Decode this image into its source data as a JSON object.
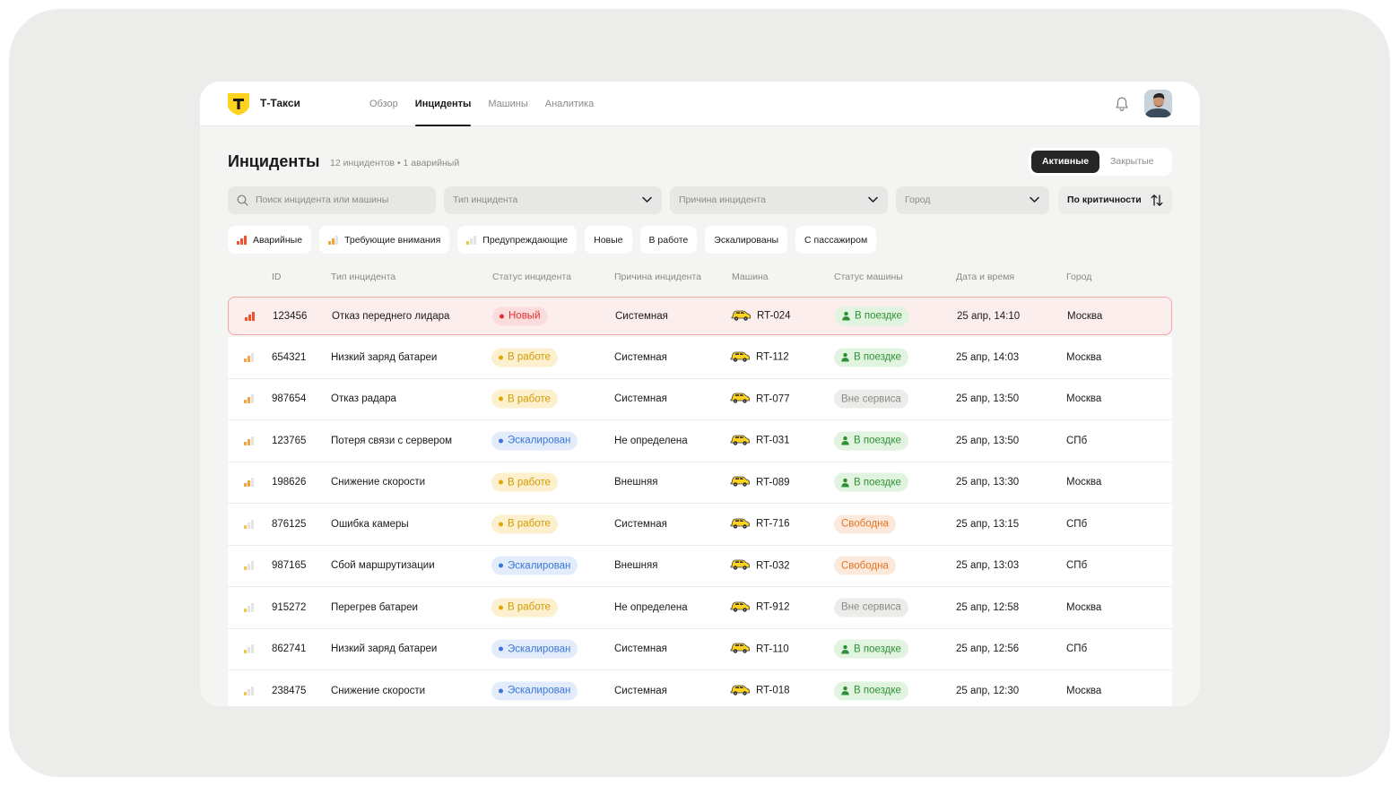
{
  "brand": "Т-Такси",
  "logo_letter": "T",
  "nav": [
    "Обзор",
    "Инциденты",
    "Машины",
    "Аналитика"
  ],
  "active_nav": "Инциденты",
  "page_title": "Инциденты",
  "summary": "12 инцидентов  •  1 аварийный",
  "tabs": [
    "Активные",
    "Закрытые"
  ],
  "active_tab": "Активные",
  "filters": {
    "search_placeholder": "Поиск инцидента или машины",
    "type_placeholder": "Тип инцидента",
    "reason_placeholder": "Причина инцидента",
    "city_placeholder": "Город",
    "sort_label": "По критичности"
  },
  "chips": [
    "Аварийные",
    "Требующие внимания",
    "Предупреждающие",
    "Новые",
    "В работе",
    "Эскалированы",
    "С пассажиром"
  ],
  "columns": [
    "ID",
    "Тип инцидента",
    "Статус инцидента",
    "Причина инцидента",
    "Машина",
    "Статус машины",
    "Дата и время",
    "Город"
  ],
  "colors": {
    "severity_high": "#f0502a",
    "severity_mid": "#f5a33a",
    "severity_low": "#f4c542",
    "severity_empty": "#e4e4e2",
    "brand_yellow": "#ffd21e"
  },
  "rows": [
    {
      "severity": 3,
      "id": "123456",
      "type": "Отказ переднего лидара",
      "status": "Новый",
      "status_kind": "new",
      "reason": "Системная",
      "car": "RT-024",
      "car_status": "В поездке",
      "car_status_kind": "trip",
      "date": "25 апр, 14:10",
      "city": "Москва"
    },
    {
      "severity": 2,
      "id": "654321",
      "type": "Низкий заряд батареи",
      "status": "В работе",
      "status_kind": "work",
      "reason": "Системная",
      "car": "RT-112",
      "car_status": "В поездке",
      "car_status_kind": "trip",
      "date": "25 апр, 14:03",
      "city": "Москва"
    },
    {
      "severity": 2,
      "id": "987654",
      "type": "Отказ радара",
      "status": "В работе",
      "status_kind": "work",
      "reason": "Системная",
      "car": "RT-077",
      "car_status": "Вне сервиса",
      "car_status_kind": "out",
      "date": "25 апр, 13:50",
      "city": "Москва"
    },
    {
      "severity": 2,
      "id": "123765",
      "type": "Потеря связи с сервером",
      "status": "Эскалирован",
      "status_kind": "esc",
      "reason": "Не определена",
      "car": "RT-031",
      "car_status": "В поездке",
      "car_status_kind": "trip",
      "date": "25 апр, 13:50",
      "city": "СПб"
    },
    {
      "severity": 2,
      "id": "198626",
      "type": "Снижение скорости",
      "status": "В работе",
      "status_kind": "work",
      "reason": "Внешняя",
      "car": "RT-089",
      "car_status": "В поездке",
      "car_status_kind": "trip",
      "date": "25 апр, 13:30",
      "city": "Москва"
    },
    {
      "severity": 1,
      "id": "876125",
      "type": "Ошибка камеры",
      "status": "В работе",
      "status_kind": "work",
      "reason": "Системная",
      "car": "RT-716",
      "car_status": "Свободна",
      "car_status_kind": "free",
      "date": "25 апр, 13:15",
      "city": "СПб"
    },
    {
      "severity": 1,
      "id": "987165",
      "type": "Сбой маршрутизации",
      "status": "Эскалирован",
      "status_kind": "esc",
      "reason": "Внешняя",
      "car": "RT-032",
      "car_status": "Свободна",
      "car_status_kind": "free",
      "date": "25 апр, 13:03",
      "city": "СПб"
    },
    {
      "severity": 1,
      "id": "915272",
      "type": "Перегрев батареи",
      "status": "В работе",
      "status_kind": "work",
      "reason": "Не определена",
      "car": "RT-912",
      "car_status": "Вне сервиса",
      "car_status_kind": "out",
      "date": "25 апр, 12:58",
      "city": "Москва"
    },
    {
      "severity": 1,
      "id": "862741",
      "type": "Низкий заряд батареи",
      "status": "Эскалирован",
      "status_kind": "esc",
      "reason": "Системная",
      "car": "RT-110",
      "car_status": "В поездке",
      "car_status_kind": "trip",
      "date": "25 апр, 12:56",
      "city": "СПб"
    },
    {
      "severity": 1,
      "id": "238475",
      "type": "Снижение скорости",
      "status": "Эскалирован",
      "status_kind": "esc",
      "reason": "Системная",
      "car": "RT-018",
      "car_status": "В поездке",
      "car_status_kind": "trip",
      "date": "25 апр, 12:30",
      "city": "Москва"
    }
  ]
}
